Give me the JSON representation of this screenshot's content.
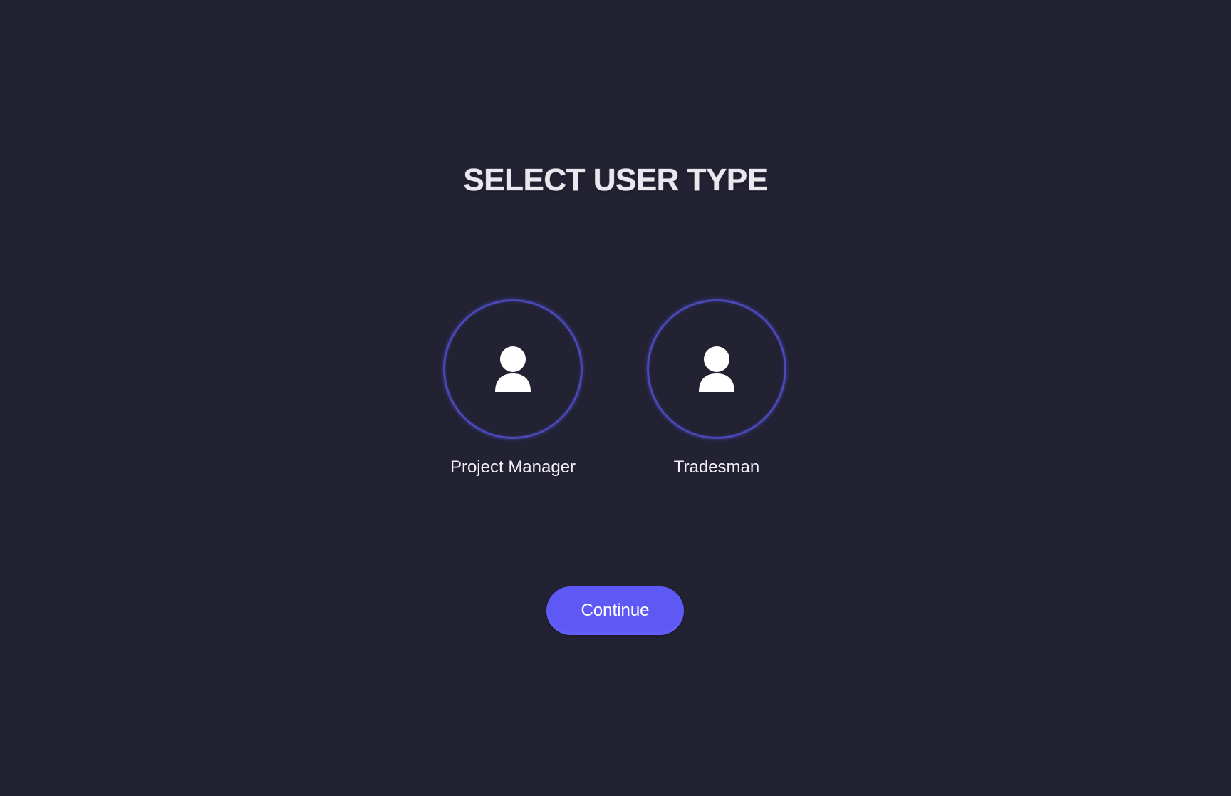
{
  "page": {
    "title": "SELECT USER TYPE"
  },
  "user_types": [
    {
      "label": "Project Manager",
      "icon": "user-icon"
    },
    {
      "label": "Tradesman",
      "icon": "user-icon"
    }
  ],
  "actions": {
    "continue_label": "Continue"
  },
  "colors": {
    "background": "#222233",
    "accent": "#5e59f5",
    "ring": "#4b48b8",
    "text": "#f1f1f5"
  }
}
